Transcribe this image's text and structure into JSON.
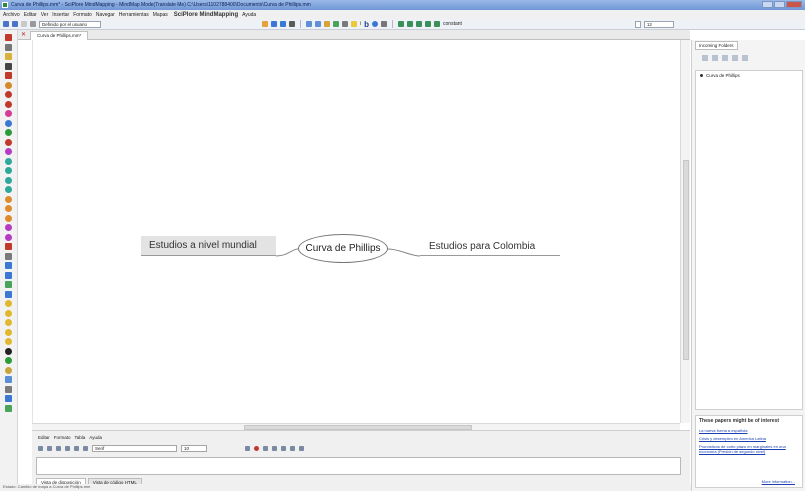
{
  "window": {
    "title": "Curva de Phillips.mm* - SciPlore MindMapping - MindMap Mode(Translate Me) C:\\Users\\1102788400\\Documents\\Curva de Phillips.mm"
  },
  "menubar": {
    "items": [
      "Archivo",
      "Editar",
      "Ver",
      "Insertar",
      "Formato",
      "Navegar",
      "Herramientas",
      "Mapas",
      "Ayuda"
    ],
    "brand": "SciPlore MindMapping"
  },
  "toolbar": {
    "style_combo": "Definido por el usuario",
    "font_size_combo": "12",
    "color_label": "constant"
  },
  "tabs": {
    "document_tab": "Curva de Phillips.mm*"
  },
  "mindmap": {
    "root": "Curva de Phillips",
    "left_child": "Estudios a nivel mundial",
    "right_child": "Estudios para Colombia"
  },
  "bottom_panel": {
    "menu": [
      "Editar",
      "Formato",
      "Tabla",
      "Ayuda"
    ],
    "font_combo": "Serif",
    "size_combo": "10",
    "tabs": [
      "Vista de disposición",
      "Vista de código HTML"
    ]
  },
  "right_panel": {
    "tab_label": "Incoming Folders",
    "tree_item": "Curva de Phillips",
    "papers_header": "These papers might be of interest",
    "links": [
      "La nueva forma a española",
      "Crisis y desempleo en America Latina",
      "Pronósticos de corto plazo en marginales en una economía (Presión de segundo nivel)"
    ],
    "more": "More information..."
  },
  "status_bar": {
    "text": "Estado: Cambio de mapa a Curva de Phillips.mm"
  },
  "colors": {
    "titlebar": "#6f97d6",
    "link": "#1a3fb0",
    "node_fill": "#e3e3e3"
  }
}
